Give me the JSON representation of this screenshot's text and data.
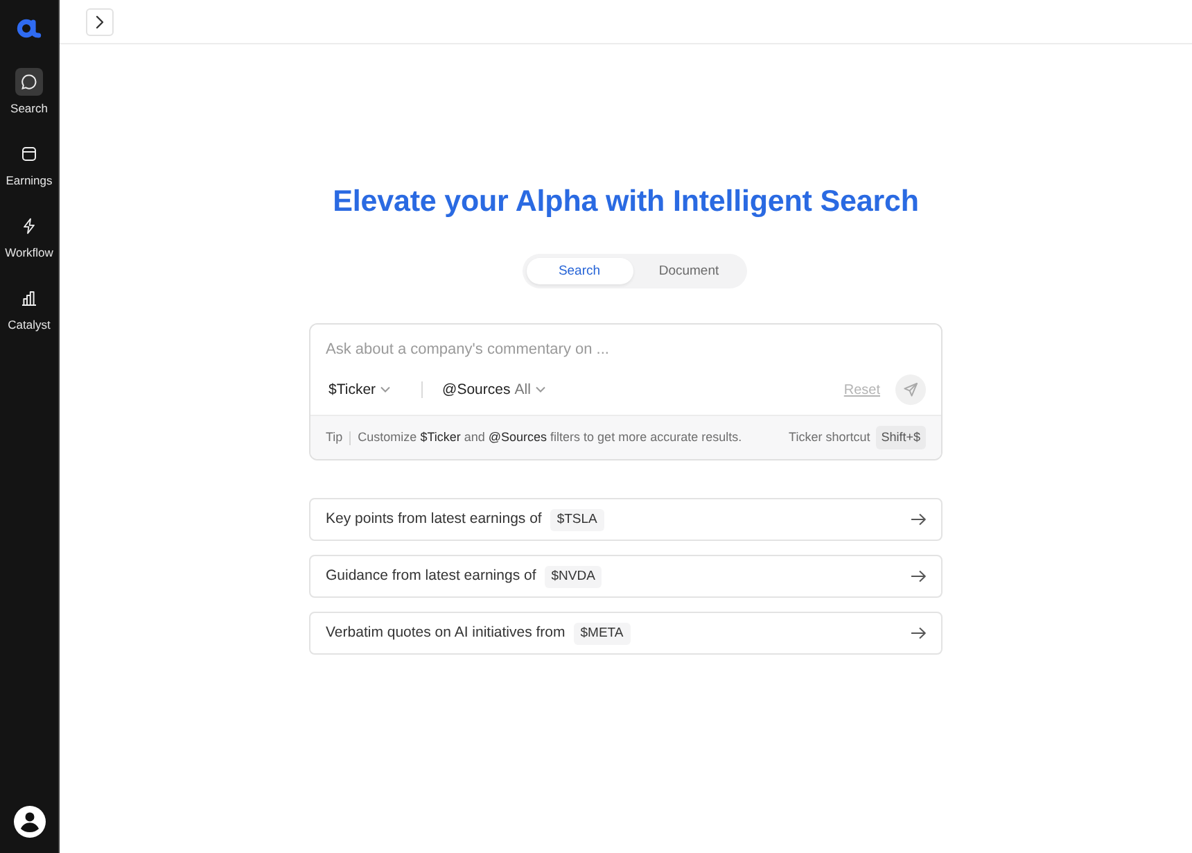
{
  "sidebar": {
    "items": [
      {
        "label": "Search",
        "kind": "chat",
        "selected": true
      },
      {
        "label": "Earnings",
        "kind": "calendar",
        "selected": false
      },
      {
        "label": "Workflow",
        "kind": "bolt",
        "selected": false
      },
      {
        "label": "Catalyst",
        "kind": "chart",
        "selected": false
      }
    ]
  },
  "heading": "Elevate your Alpha with Intelligent Search",
  "mode_tabs": [
    {
      "label": "Search",
      "selected": true
    },
    {
      "label": "Document",
      "selected": false
    }
  ],
  "search_box": {
    "placeholder": "Ask about a company's commentary on ...",
    "filters": [
      {
        "label": "$Ticker"
      },
      {
        "label": "@Sources",
        "value": "All"
      }
    ],
    "reset": {
      "label": "Reset",
      "disabled": true
    },
    "send_button": {
      "disabled": true
    },
    "tip_label": "Tip",
    "tip": "Customize **$Ticker** and **@Sources** filters to get more accurate results.",
    "shortcut_label": "Ticker shortcut",
    "shortcut_key": "Shift+$"
  },
  "suggestions": [
    {
      "text": "Key points from latest earnings of",
      "ticker": "$TSLA"
    },
    {
      "text": "Guidance from latest earnings of",
      "ticker": "$NVDA"
    },
    {
      "text": "Verbatim quotes on AI initiatives from",
      "ticker": "$META"
    }
  ]
}
